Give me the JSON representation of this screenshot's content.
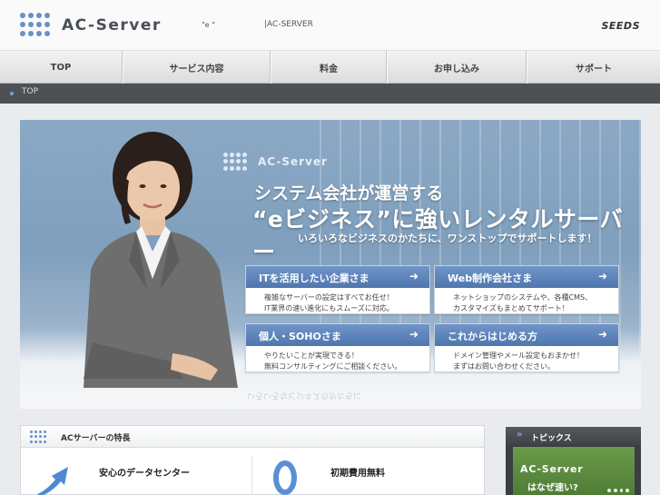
{
  "header": {
    "logo_text": "AC-Server",
    "tagline": "\"e          \"",
    "tagline_product": "|AC-SERVER",
    "brand": "SEEDS"
  },
  "nav": {
    "items": [
      {
        "label": "TOP"
      },
      {
        "label": "サービス内容"
      },
      {
        "label": "料金"
      },
      {
        "label": "お申し込み"
      },
      {
        "label": "サポート"
      }
    ]
  },
  "breadcrumb": {
    "current": "TOP"
  },
  "hero": {
    "logo_text": "AC-Server",
    "headline1": "システム会社が運営する",
    "headline2": "“eビジネス”に強いレンタルサーバー",
    "subheadline": "いろいろなビジネスのかたちに、ワンストップでサポートします！",
    "reflection": "いろいろなビジネスのかたちに",
    "cards": [
      {
        "title": "ITを活用したい企業さま",
        "line1": "複雑なサーバーの設定はすべてお任せ！",
        "line2": "IT業界の速い進化にもスムーズに対応。"
      },
      {
        "title": "Web制作会社さま",
        "line1": "ネットショップのシステムや、各種CMS、",
        "line2": "カスタマイズもまとめてサポート！"
      },
      {
        "title": "個人・SOHOさま",
        "line1": "やりたいことが実現できる！",
        "line2": "無料コンサルティングにご相談ください。"
      },
      {
        "title": "これからはじめる方",
        "line1": "ドメイン管理やメール設定もおまかせ！",
        "line2": "まずはお問い合わせください。"
      }
    ],
    "arrow": "➜"
  },
  "features": {
    "title": "ACサーバーの特長",
    "items": [
      {
        "title": "安心のデータセンター"
      },
      {
        "title": "初期費用無料"
      }
    ]
  },
  "topics": {
    "chevron": "»",
    "title": "トピックス",
    "banner_text": "AC-Server",
    "banner_question": "はなぜ速い?"
  },
  "colors": {
    "accent_blue": "#5a80b8",
    "breadcrumb_bg": "#4d5054",
    "topics_green": "#5c8b40"
  },
  "icons": {
    "feature_icon_1": "rising-arrow-icon",
    "feature_icon_2": "zero-yen-icon"
  }
}
